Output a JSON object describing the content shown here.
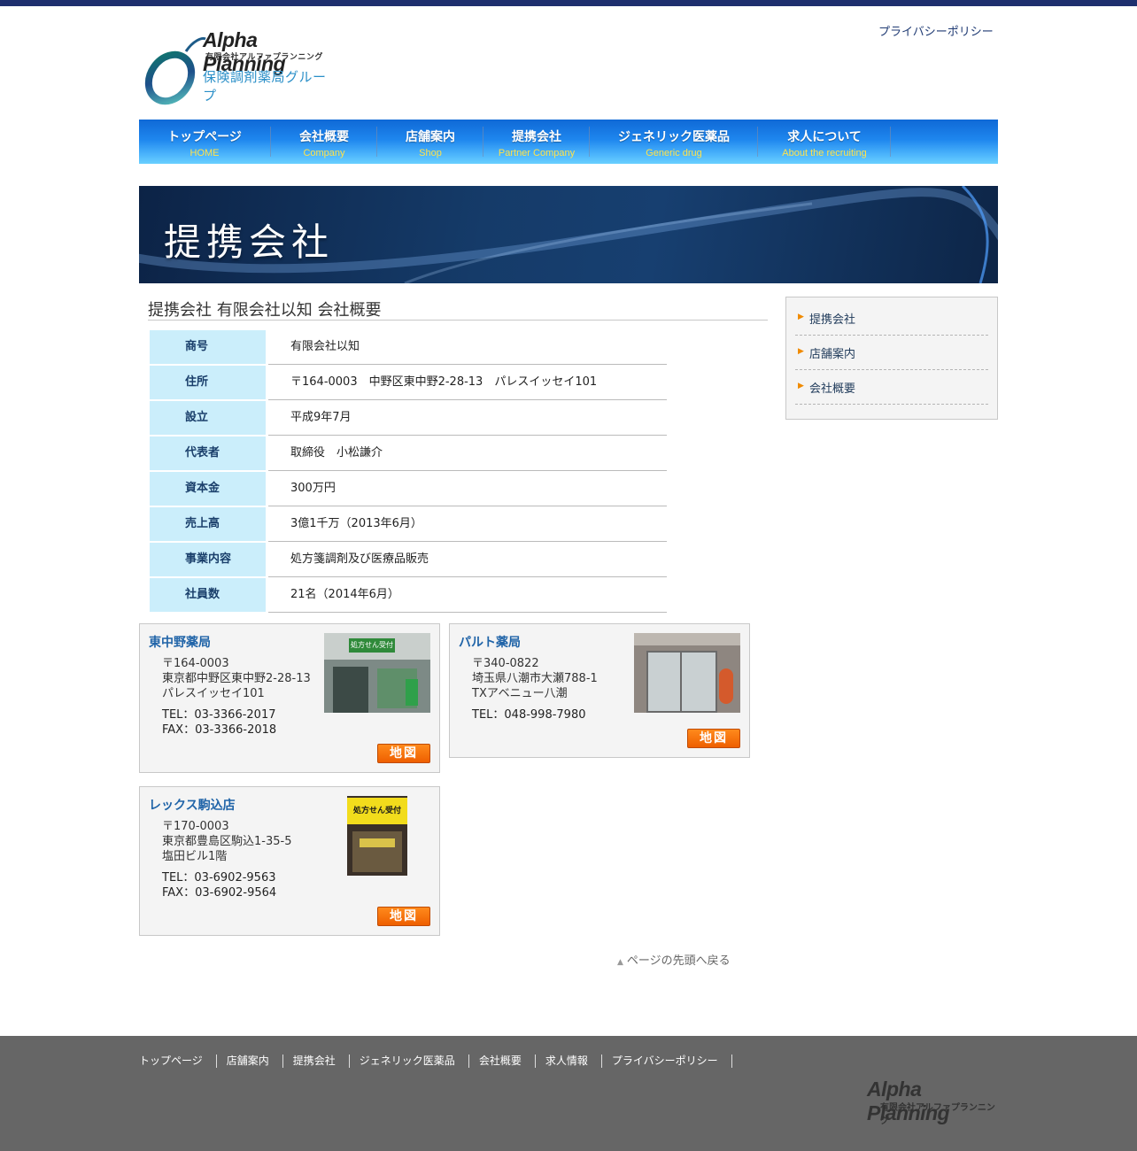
{
  "header": {
    "logo_title": "Alpha Planning",
    "logo_subtitle": "有限会社アルファプランニング",
    "logo_group": "保険調剤薬局グループ",
    "privacy_link": "プライバシーポリシー"
  },
  "nav": {
    "items": [
      {
        "jp": "トップページ",
        "en": "HOME"
      },
      {
        "jp": "会社概要",
        "en": "Company"
      },
      {
        "jp": "店舗案内",
        "en": "Shop"
      },
      {
        "jp": "提携会社",
        "en": "Partner Company"
      },
      {
        "jp": "ジェネリック医薬品",
        "en": "Generic drug"
      },
      {
        "jp": "求人について",
        "en": "About the recruiting"
      }
    ]
  },
  "banner": {
    "title": "提携会社"
  },
  "main": {
    "title": "提携会社 有限会社以知 会社概要",
    "company_rows": [
      {
        "label": "商号",
        "value": "有限会社以知"
      },
      {
        "label": "住所",
        "value": "〒164-0003　中野区東中野2-28-13　パレスイッセイ101"
      },
      {
        "label": "設立",
        "value": "平成9年7月"
      },
      {
        "label": "代表者",
        "value": "取締役　小松謙介"
      },
      {
        "label": "資本金",
        "value": "300万円"
      },
      {
        "label": "売上高",
        "value": "3億1千万（2013年6月）"
      },
      {
        "label": "事業内容",
        "value": "処方箋調剤及び医療品販売"
      },
      {
        "label": "社員数",
        "value": "21名（2014年6月）"
      }
    ],
    "shops": [
      {
        "name": "東中野薬局",
        "postal": "〒164-0003",
        "address1": "東京都中野区東中野2-28-13",
        "address2": "パレスイッセイ101",
        "tel": "TEL：03-3366-2017　FAX：03-3366-2018",
        "photo_sign": "処方せん受付",
        "map_label": "地図"
      },
      {
        "name": "パルト薬局",
        "postal": "〒340-0822",
        "address1": "埼玉県八潮市大瀬788-1",
        "address2": "TXアベニュー八潮",
        "tel": "TEL：048-998-7980",
        "photo_sign": "",
        "map_label": "地図"
      },
      {
        "name": "レックス駒込店",
        "postal": "〒170-0003",
        "address1": "東京都豊島区駒込1-35-5",
        "address2": "塩田ビル1階",
        "tel": "TEL：03-6902-9563　FAX：03-6902-9564",
        "photo_sign": "処方せん受付",
        "map_label": "地図"
      }
    ],
    "page_top": "ページの先頭へ戻る"
  },
  "sidebar": {
    "items": [
      {
        "label": "提携会社"
      },
      {
        "label": "店舗案内"
      },
      {
        "label": "会社概要"
      }
    ]
  },
  "footer": {
    "links": [
      "トップページ",
      "店舗案内",
      "提携会社",
      "ジェネリック医薬品",
      "会社概要",
      "求人情報",
      "プライバシーポリシー"
    ],
    "logo_title": "Alpha Planning",
    "logo_subtitle": "有限会社アルファプランニング"
  },
  "colors": {
    "topbar": "#1e2f6e",
    "nav_gradient_top": "#0f69d6",
    "nav_gradient_bottom": "#6ad0ff",
    "table_header_bg": "#cbeefb",
    "shop_name": "#2064a8",
    "map_button": "#ff7a10",
    "footer_bg": "#666666"
  }
}
